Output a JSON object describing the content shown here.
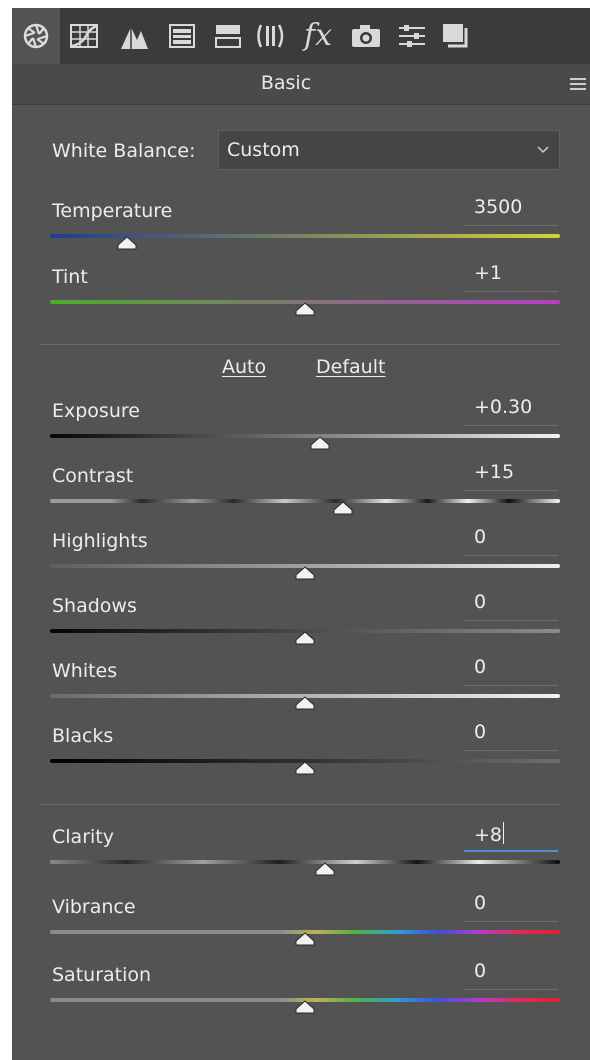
{
  "toolbar": {
    "tabs": [
      {
        "icon": "aperture-icon",
        "active": true
      },
      {
        "icon": "tone-curve-grid-icon"
      },
      {
        "icon": "detail-triangles-icon"
      },
      {
        "icon": "hsl-panel-icon"
      },
      {
        "icon": "split-toning-icon"
      },
      {
        "icon": "lens-corrections-icon"
      },
      {
        "icon": "fx-icon",
        "glyph": "fx"
      },
      {
        "icon": "camera-icon"
      },
      {
        "icon": "presets-sliders-icon"
      },
      {
        "icon": "snapshots-icon"
      }
    ]
  },
  "panel": {
    "title": "Basic",
    "menu_icon": "panel-menu-icon"
  },
  "white_balance": {
    "label": "White Balance:",
    "value": "Custom"
  },
  "temperature": {
    "label": "Temperature",
    "value": "3500",
    "position": 0.15,
    "colors": [
      "#1f3b8f",
      "#d7d232"
    ]
  },
  "tint": {
    "label": "Tint",
    "value": "+1",
    "position": 0.5,
    "colors": [
      "#4dac2a",
      "#b63ec4"
    ]
  },
  "tone_links": {
    "auto": "Auto",
    "default": "Default"
  },
  "exposure": {
    "label": "Exposure",
    "value": "+0.30",
    "position": 0.53
  },
  "contrast": {
    "label": "Contrast",
    "value": "+15",
    "position": 0.575
  },
  "highlights": {
    "label": "Highlights",
    "value": "0",
    "position": 0.5
  },
  "shadows": {
    "label": "Shadows",
    "value": "0",
    "position": 0.5
  },
  "whites": {
    "label": "Whites",
    "value": "0",
    "position": 0.5
  },
  "blacks": {
    "label": "Blacks",
    "value": "0",
    "position": 0.5
  },
  "clarity": {
    "label": "Clarity",
    "value": "+8",
    "position": 0.54,
    "editing": true
  },
  "vibrance": {
    "label": "Vibrance",
    "value": "0",
    "position": 0.5
  },
  "saturation": {
    "label": "Saturation",
    "value": "0",
    "position": 0.5
  }
}
